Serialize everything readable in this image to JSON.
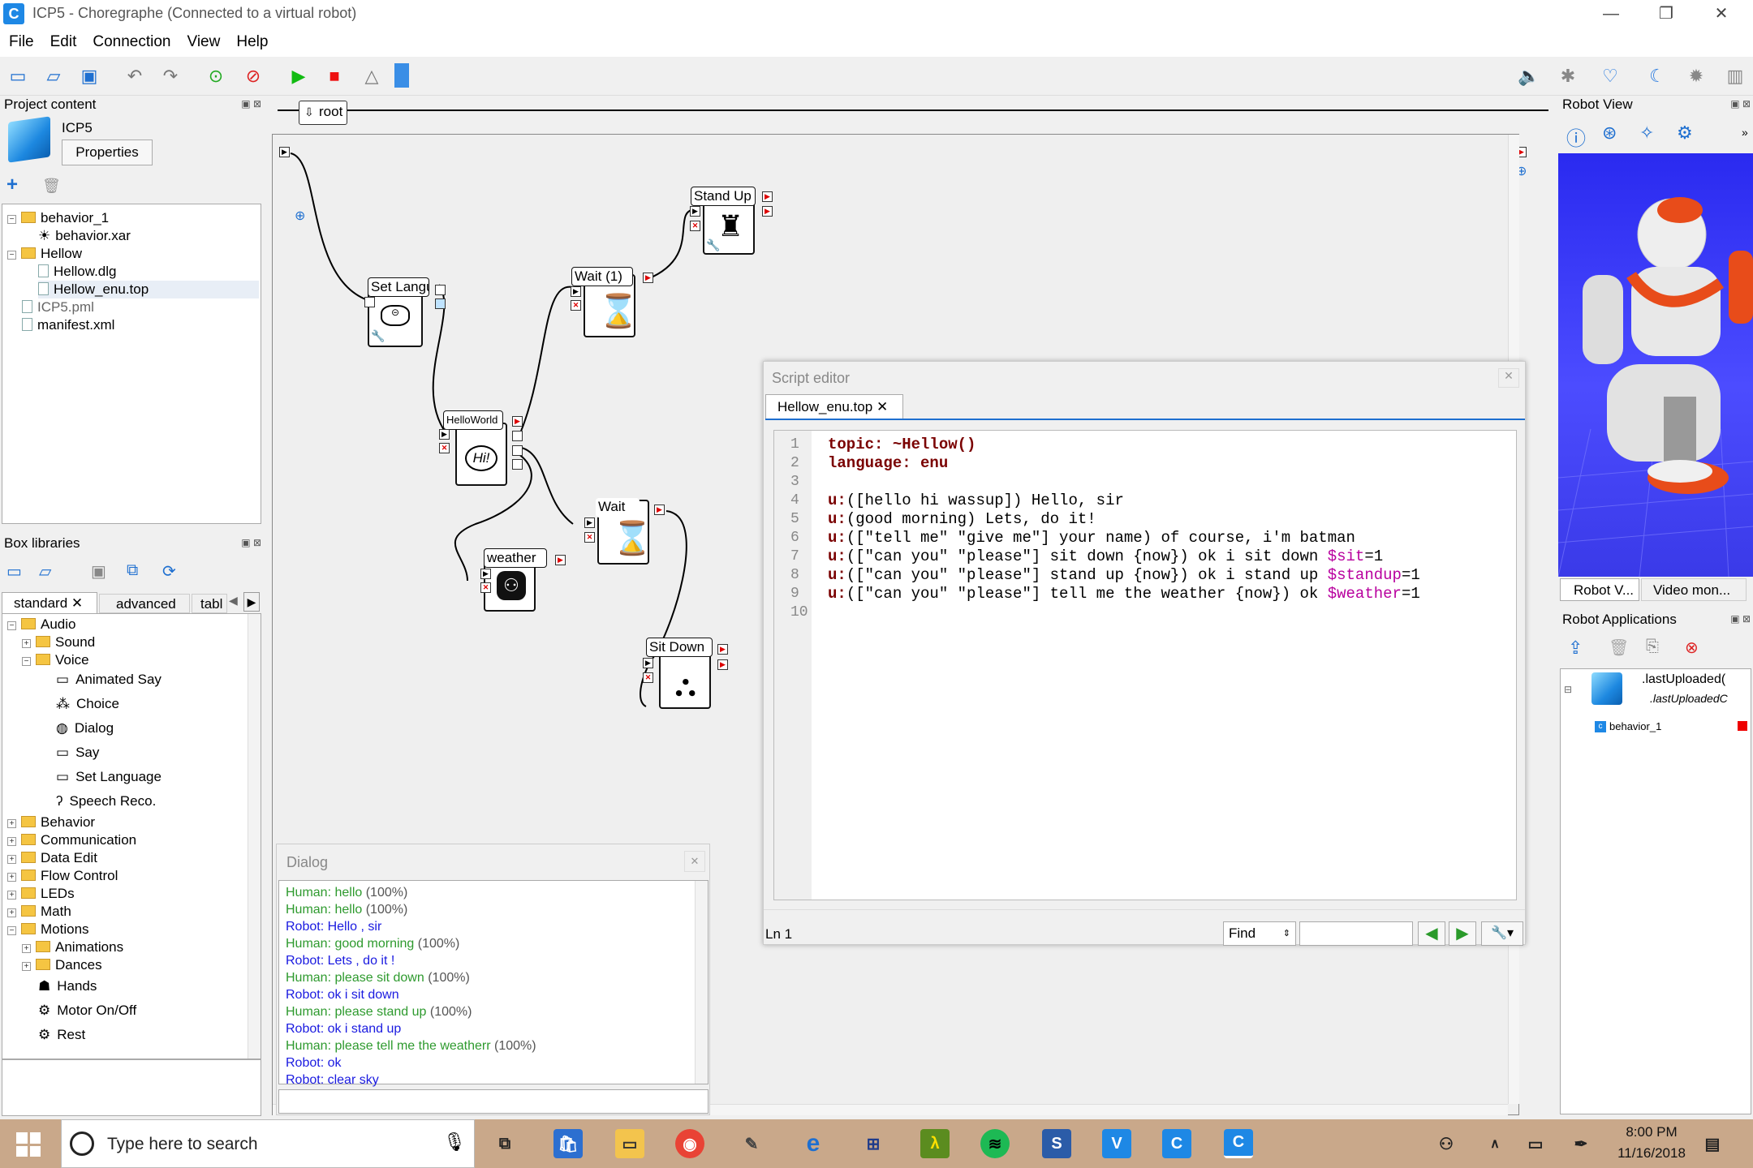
{
  "window": {
    "title": "ICP5 - Choregraphe (Connected to a virtual robot)",
    "app_icon": "C",
    "min": "—",
    "restore": "❐",
    "close": "✕"
  },
  "menu": [
    "File",
    "Edit",
    "Connection",
    "View",
    "Help"
  ],
  "project": {
    "header": "Project content",
    "name": "ICP5",
    "properties_btn": "Properties",
    "items": [
      "behavior_1",
      "behavior.xar",
      "Hellow",
      "Hellow.dlg",
      "Hellow_enu.top",
      "ICP5.pml",
      "manifest.xml"
    ]
  },
  "libraries": {
    "header": "Box libraries",
    "tabs": [
      "standard",
      "advanced",
      "tabl"
    ],
    "items": [
      "Audio",
      "Sound",
      "Voice",
      "Animated Say",
      "Choice",
      "Dialog",
      "Say",
      "Set Language",
      "Speech Reco.",
      "Behavior",
      "Communication",
      "Data Edit",
      "Flow Control",
      "LEDs",
      "Math",
      "Motions",
      "Animations",
      "Dances",
      "Hands",
      "Motor On/Off",
      "Rest"
    ]
  },
  "breadcrumb": "root",
  "boxes": {
    "set_language": "Set Languac",
    "hello_world": "HelloWorld",
    "hi": "Hi!",
    "wait1": "Wait (1)",
    "stand_up": "Stand Up",
    "wait2": "Wait",
    "weather": "weather",
    "sit_down": "Sit Down"
  },
  "script_editor": {
    "title": "Script editor",
    "tab": "Hellow_enu.top",
    "tab_close": "✕",
    "status": "Ln 1",
    "find_label": "Find",
    "line_numbers": [
      "1",
      "2",
      "3",
      "4",
      "5",
      "6",
      "7",
      "8",
      "9",
      "10"
    ],
    "lines": {
      "l1a": "topic:",
      "l1b": " ~Hellow()",
      "l2a": "language:",
      "l2b": " enu",
      "l4a": "u:",
      "l4b": "([hello hi wassup]) Hello, sir",
      "l5a": "u:",
      "l5b": "(good morning) Lets, do it!",
      "l6a": "u:",
      "l6b": "([\"tell me\" \"give me\"] your name) of course, i'm batman",
      "l7a": "u:",
      "l7b": "([\"can you\" \"please\"] sit down {now}) ok i sit down ",
      "l7c": "$sit",
      "l7d": "=1",
      "l8a": "u:",
      "l8b": "([\"can you\" \"please\"] stand up {now}) ok i stand up ",
      "l8c": "$standup",
      "l8d": "=1",
      "l9a": "u:",
      "l9b": "([\"can you\" \"please\"] tell me the weather {now}) ok ",
      "l9c": "$weather",
      "l9d": "=1"
    }
  },
  "dialog": {
    "title": "Dialog",
    "lines": [
      {
        "who": "Human: hello",
        "pct": " (100%)"
      },
      {
        "who": "Human: hello",
        "pct": " (100%)"
      },
      {
        "who": "Robot: Hello , sir",
        "pct": ""
      },
      {
        "who": "Human: good morning",
        "pct": " (100%)"
      },
      {
        "who": "Robot: Lets , do it   !",
        "pct": ""
      },
      {
        "who": "Human: please sit down",
        "pct": " (100%)"
      },
      {
        "who": "Robot: ok i sit down",
        "pct": ""
      },
      {
        "who": "Human: please stand up",
        "pct": " (100%)"
      },
      {
        "who": "Robot: ok i stand up",
        "pct": ""
      },
      {
        "who": "Human: please tell me the weatherr",
        "pct": " (100%)"
      },
      {
        "who": "Robot: ok",
        "pct": ""
      },
      {
        "who": "Robot: clear sky",
        "pct": ""
      }
    ]
  },
  "robot_view": {
    "header": "Robot View",
    "tab1": "Robot V...",
    "tab2": "Video mon..."
  },
  "robot_apps": {
    "header": "Robot Applications",
    "app1": ".lastUploaded(",
    "app1_sub": ".lastUploadedC",
    "behavior": "behavior_1"
  },
  "taskbar": {
    "search_placeholder": "Type here to search",
    "time": "8:00 PM",
    "date": "11/16/2018"
  },
  "colors": {
    "human": "#2e9a2e",
    "robot": "#1a1ae0",
    "keyword": "#7a0000",
    "variable": "#b8009e"
  }
}
